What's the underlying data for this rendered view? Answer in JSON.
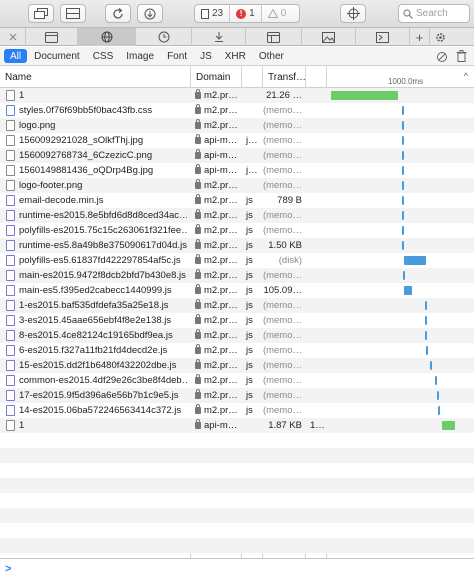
{
  "toolbar": {
    "resource_count": "23",
    "error_count": "1",
    "warning_count": "0",
    "search_placeholder": "Search"
  },
  "tabs": [
    {
      "icon": "elements-icon"
    },
    {
      "icon": "network-icon",
      "active": true
    },
    {
      "icon": "timelines-icon"
    },
    {
      "icon": "debugger-icon"
    },
    {
      "icon": "storage-icon"
    },
    {
      "icon": "canvas-icon"
    },
    {
      "icon": "console-icon"
    },
    {
      "icon": "new-tab-icon"
    },
    {
      "icon": "settings-icon"
    }
  ],
  "filters": [
    "All",
    "Document",
    "CSS",
    "Image",
    "Font",
    "JS",
    "XHR",
    "Other"
  ],
  "columns": {
    "name": "Name",
    "domain": "Domain",
    "transfer": "Transf…",
    "timeline_tick": "1000.0ms"
  },
  "rows": [
    {
      "name": "1",
      "icon": "doc",
      "domain": "m2.pr…",
      "type": "",
      "size": "21.26 …",
      "gray": false,
      "bar": {
        "start": 0,
        "width": 67,
        "color": "#6acd6a"
      }
    },
    {
      "name": "styles.0f76f69bb5f0bac43fb.css",
      "icon": "css",
      "domain": "m2.pr…",
      "type": "",
      "size": "(memo…",
      "gray": true,
      "bar": {
        "start": 71,
        "width": 2,
        "color": "#4a9bd9"
      }
    },
    {
      "name": "logo.png",
      "icon": "img",
      "domain": "m2.pr…",
      "type": "",
      "size": "(memo…",
      "gray": true,
      "bar": {
        "start": 71,
        "width": 2,
        "color": "#4a9bd9"
      }
    },
    {
      "name": "1560092921028_sOlkfThj.jpg",
      "icon": "img",
      "domain": "api-m…",
      "type": "j…",
      "size": "(memo…",
      "gray": true,
      "bar": {
        "start": 71,
        "width": 2,
        "color": "#4a9bd9"
      }
    },
    {
      "name": "1560092768734_6CzezicC.png",
      "icon": "img",
      "domain": "api-m…",
      "type": "",
      "size": "(memo…",
      "gray": true,
      "bar": {
        "start": 71,
        "width": 2,
        "color": "#4a9bd9"
      }
    },
    {
      "name": "1560149881436_oQDrp4Bg.jpg",
      "icon": "img",
      "domain": "api-m…",
      "type": "j…",
      "size": "(memo…",
      "gray": true,
      "bar": {
        "start": 71,
        "width": 2,
        "color": "#4a9bd9"
      }
    },
    {
      "name": "logo-footer.png",
      "icon": "img",
      "domain": "m2.pr…",
      "type": "",
      "size": "(memo…",
      "gray": true,
      "bar": {
        "start": 71,
        "width": 2,
        "color": "#4a9bd9"
      }
    },
    {
      "name": "email-decode.min.js",
      "icon": "js",
      "domain": "m2.pr…",
      "type": "js",
      "size": "789 B",
      "gray": false,
      "bar": {
        "start": 71,
        "width": 2,
        "color": "#4a9bd9"
      }
    },
    {
      "name": "runtime-es2015.8e5bfd6d8d8ced34ac…",
      "icon": "js",
      "domain": "m2.pr…",
      "type": "js",
      "size": "(memo…",
      "gray": true,
      "bar": {
        "start": 71,
        "width": 2,
        "color": "#4a9bd9"
      }
    },
    {
      "name": "polyfills-es2015.75c15c263061f321fee…",
      "icon": "js",
      "domain": "m2.pr…",
      "type": "js",
      "size": "(memo…",
      "gray": true,
      "bar": {
        "start": 71,
        "width": 2,
        "color": "#4a9bd9"
      }
    },
    {
      "name": "runtime-es5.8a49b8e375090617d04d.js",
      "icon": "js",
      "domain": "m2.pr…",
      "type": "js",
      "size": "1.50 KB",
      "gray": false,
      "bar": {
        "start": 71,
        "width": 2,
        "color": "#4a9bd9"
      }
    },
    {
      "name": "polyfills-es5.61837fd422297854af5c.js",
      "icon": "js",
      "domain": "m2.pr…",
      "type": "js",
      "size": "(disk)",
      "gray": true,
      "bar": {
        "start": 73,
        "width": 22,
        "color": "#4a9bd9"
      }
    },
    {
      "name": "main-es2015.9472f8dcb2bfd7b430e8.js",
      "icon": "js",
      "domain": "m2.pr…",
      "type": "js",
      "size": "(memo…",
      "gray": true,
      "bar": {
        "start": 72,
        "width": 2,
        "color": "#4a9bd9"
      }
    },
    {
      "name": "main-es5.f395ed2cabecc1440999.js",
      "icon": "js",
      "domain": "m2.pr…",
      "type": "js",
      "size": "105.09…",
      "gray": false,
      "bar": {
        "start": 73,
        "width": 8,
        "color": "#4a9bd9"
      }
    },
    {
      "name": "1-es2015.baf535dfdefa35a25e18.js",
      "icon": "js",
      "domain": "m2.pr…",
      "type": "js",
      "size": "(memo…",
      "gray": true,
      "bar": {
        "start": 94,
        "width": 2,
        "color": "#4a9bd9"
      }
    },
    {
      "name": "3-es2015.45aae656ebf4f8e2e138.js",
      "icon": "js",
      "domain": "m2.pr…",
      "type": "js",
      "size": "(memo…",
      "gray": true,
      "bar": {
        "start": 94,
        "width": 2,
        "color": "#4a9bd9"
      }
    },
    {
      "name": "8-es2015.4ce82124c19165bdf9ea.js",
      "icon": "js",
      "domain": "m2.pr…",
      "type": "js",
      "size": "(memo…",
      "gray": true,
      "bar": {
        "start": 94,
        "width": 2,
        "color": "#4a9bd9"
      }
    },
    {
      "name": "6-es2015.f327a11fb21fd4decd2e.js",
      "icon": "js",
      "domain": "m2.pr…",
      "type": "js",
      "size": "(memo…",
      "gray": true,
      "bar": {
        "start": 95,
        "width": 2,
        "color": "#4a9bd9"
      }
    },
    {
      "name": "15-es2015.dd2f1b6480f432202dbe.js",
      "icon": "js",
      "domain": "m2.pr…",
      "type": "js",
      "size": "(memo…",
      "gray": true,
      "bar": {
        "start": 99,
        "width": 2,
        "color": "#4a9bd9"
      }
    },
    {
      "name": "common-es2015.4df29e26c3be8f4deb…",
      "icon": "js",
      "domain": "m2.pr…",
      "type": "js",
      "size": "(memo…",
      "gray": true,
      "bar": {
        "start": 104,
        "width": 2,
        "color": "#4a9bd9"
      }
    },
    {
      "name": "17-es2015.9f5d396a6e56b7b1c9e5.js",
      "icon": "js",
      "domain": "m2.pr…",
      "type": "js",
      "size": "(memo…",
      "gray": true,
      "bar": {
        "start": 106,
        "width": 2,
        "color": "#4a9bd9"
      }
    },
    {
      "name": "14-es2015.06ba572246563414c372.js",
      "icon": "js",
      "domain": "m2.pr…",
      "type": "js",
      "size": "(memo…",
      "gray": true,
      "bar": {
        "start": 107,
        "width": 2,
        "color": "#4a9bd9"
      }
    },
    {
      "name": "1",
      "icon": "doc",
      "domain": "api-m…",
      "type": "",
      "size": "1.87 KB",
      "gray": false,
      "timecol": "1…",
      "bar": {
        "start": 111,
        "width": 13,
        "color": "#6acd6a"
      }
    }
  ]
}
